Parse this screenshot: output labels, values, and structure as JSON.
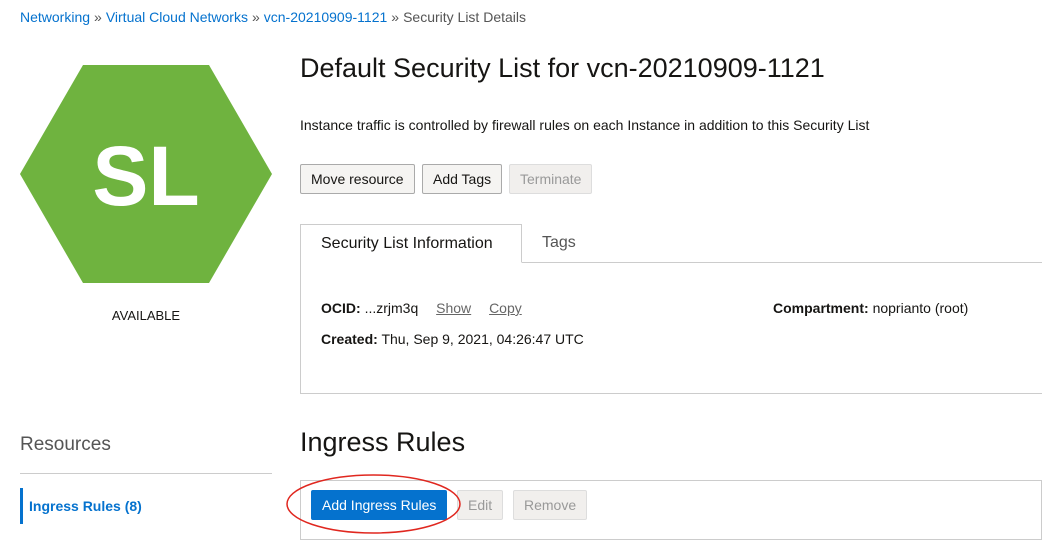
{
  "breadcrumb": {
    "items": [
      "Networking",
      "Virtual Cloud Networks",
      "vcn-20210909-1121"
    ],
    "separator": "»",
    "current": "Security List Details"
  },
  "resource_icon": {
    "initials": "SL",
    "color": "#6fb33f",
    "icon": "hexagon-icon"
  },
  "status": "AVAILABLE",
  "title": "Default Security List for vcn-20210909-1121",
  "description": "Instance traffic is controlled by firewall rules on each Instance in addition to this Security List",
  "actions": {
    "move": "Move resource",
    "add_tags": "Add Tags",
    "terminate": "Terminate"
  },
  "tabs": {
    "info": "Security List Information",
    "tags": "Tags"
  },
  "info": {
    "ocid_label": "OCID:",
    "ocid_value": "...zrjm3q",
    "show": "Show",
    "copy": "Copy",
    "created_label": "Created:",
    "created_value": "Thu, Sep 9, 2021, 04:26:47 UTC",
    "compartment_label": "Compartment:",
    "compartment_value": "noprianto (root)"
  },
  "resources": {
    "title": "Resources",
    "items": [
      "Ingress Rules (8)"
    ]
  },
  "ingress": {
    "title": "Ingress Rules",
    "add": "Add Ingress Rules",
    "edit": "Edit",
    "remove": "Remove"
  },
  "colors": {
    "accent": "#0572ce",
    "highlight": "#e0271f"
  }
}
